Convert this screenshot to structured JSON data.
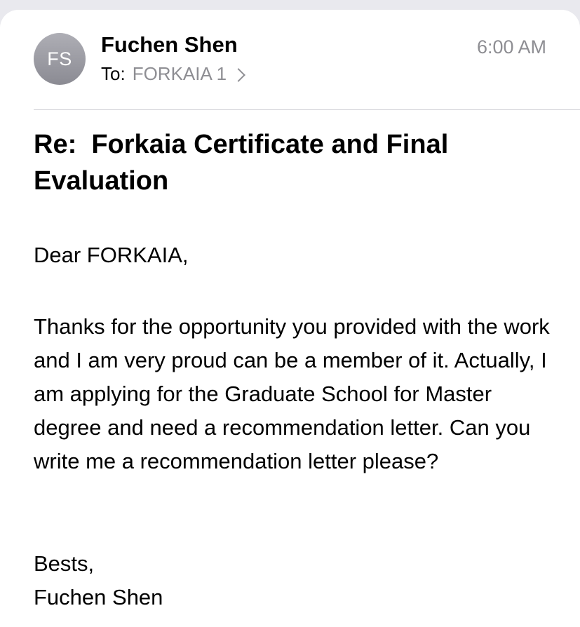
{
  "email": {
    "sender_initials": "FS",
    "sender_name": "Fuchen Shen",
    "to_label": "To:",
    "recipient": "FORKAIA 1",
    "time": "6:00 AM",
    "subject": "Re:  Forkaia Certificate and Final Evaluation",
    "greeting": "Dear FORKAIA,",
    "body": "Thanks for the opportunity you provided with the work and I am very proud can be a member of it. Actually, I am applying for the Graduate School for Master degree and need a recommendation letter. Can you write me a recommendation letter please?",
    "signoff": "Bests,",
    "signature": "Fuchen Shen"
  },
  "icons": {
    "recipient_chevron": "chevron-right-icon"
  },
  "colors": {
    "avatar": "#9a9aa1",
    "secondary_text": "#8e8e93",
    "divider": "#d1d1d6"
  }
}
